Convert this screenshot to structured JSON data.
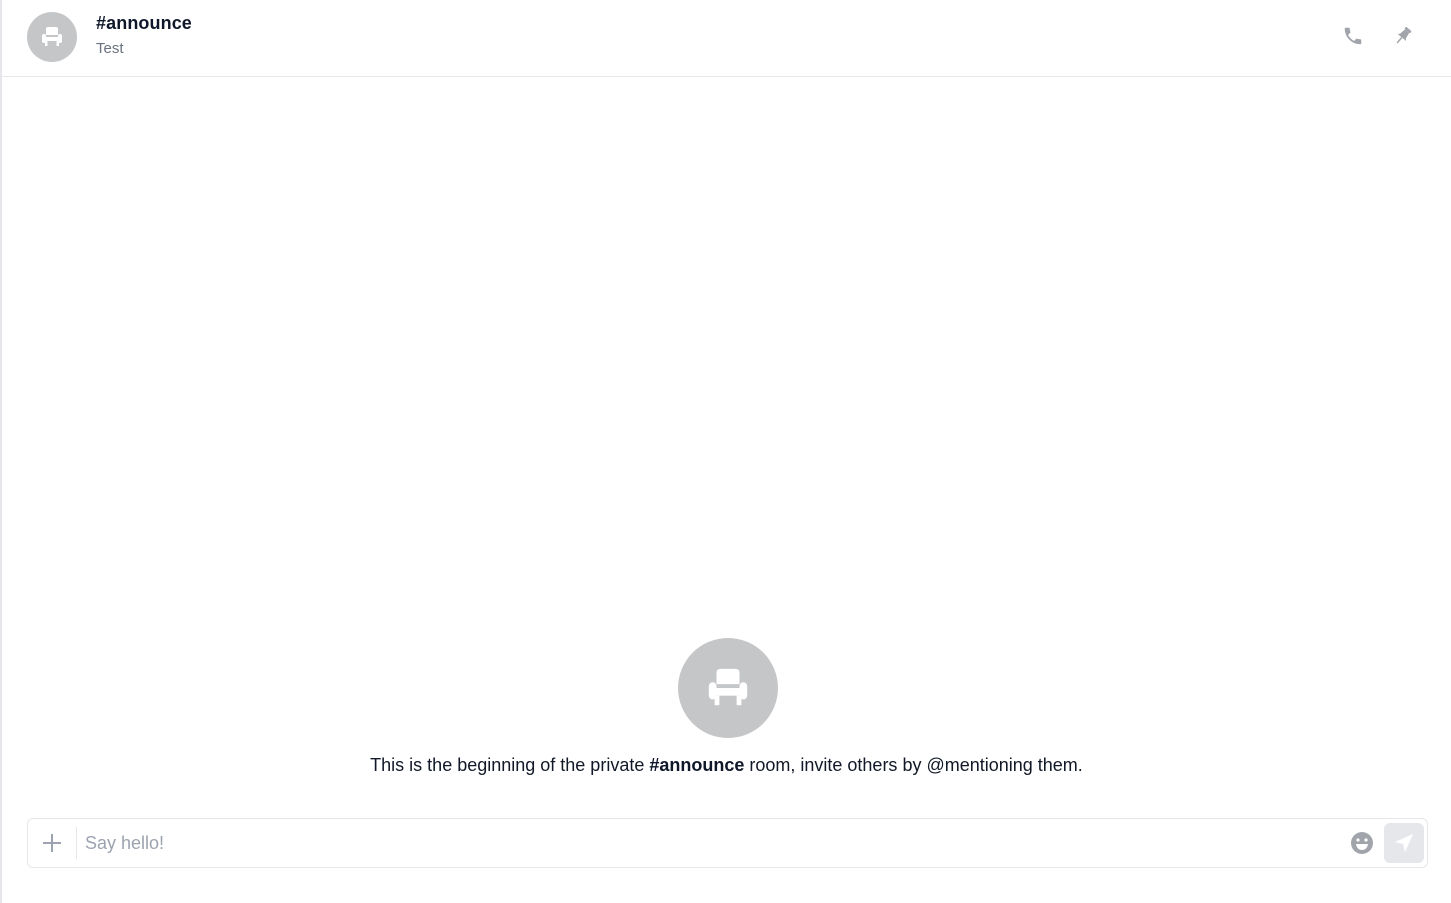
{
  "room": {
    "title": "#announce",
    "topic": "Test",
    "avatar_icon": "armchair-icon"
  },
  "header_actions": {
    "call_icon": "phone-icon",
    "pin_icon": "pin-icon"
  },
  "intro": {
    "prefix": "This is the beginning of the private ",
    "room_name": "#announce",
    "suffix": " room, invite others by @mentioning them."
  },
  "composer": {
    "placeholder": "Say hello!",
    "value": "",
    "attach_icon": "plus-icon",
    "emoji_icon": "emoji-icon",
    "send_icon": "send-icon"
  },
  "colors": {
    "avatar_bg": "#c4c6c8",
    "icon_gray": "#9ca3af",
    "border": "#e5e7eb",
    "text": "#111827"
  }
}
